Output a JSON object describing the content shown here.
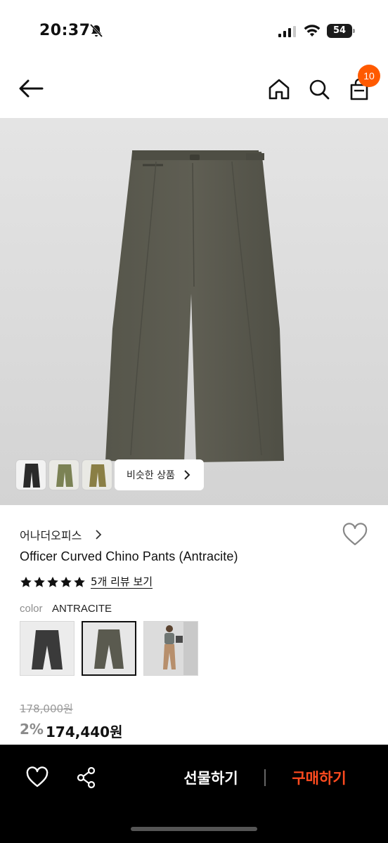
{
  "status_bar": {
    "time": "20:37",
    "battery": "54"
  },
  "nav": {
    "cart_count": "10"
  },
  "gallery": {
    "similar_label": "비슷한 상품"
  },
  "product": {
    "brand": "어나더오피스",
    "title": "Officer Curved Chino Pants (Antracite)",
    "rating_stars": 5,
    "review_link": "5개 리뷰 보기",
    "color_label": "color",
    "color_value": "ANTRACITE",
    "original_price": "178,000원",
    "discount": "2%",
    "sale_price": "174,440원"
  },
  "bottom_bar": {
    "gift_label": "선물하기",
    "buy_label": "구매하기"
  },
  "colors": {
    "badge": "#ff5a00",
    "buy": "#ff4b1f",
    "pants": "#5c5b50"
  },
  "icons": [
    "bell-muted-icon",
    "signal-icon",
    "wifi-icon",
    "battery-icon",
    "back-arrow-icon",
    "home-icon",
    "search-icon",
    "shopping-bag-icon",
    "chevron-right-icon",
    "heart-icon",
    "star-icon",
    "share-icon"
  ]
}
